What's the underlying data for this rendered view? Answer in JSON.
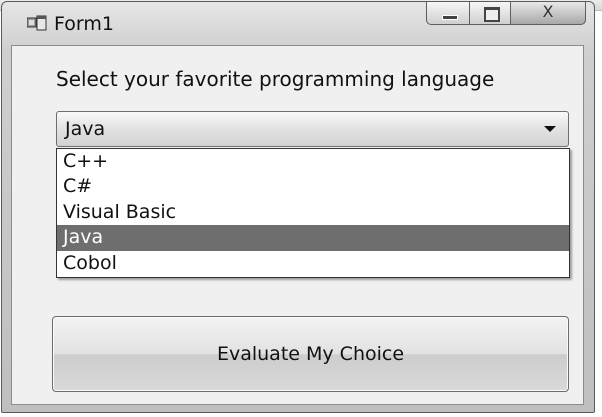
{
  "window": {
    "title": "Form1",
    "controls": {
      "minimize": "minimize",
      "maximize": "maximize",
      "close": "X"
    }
  },
  "form": {
    "prompt": "Select your favorite programming language",
    "combo": {
      "selected": "Java",
      "options": [
        "C++",
        "C#",
        "Visual Basic",
        "Java",
        "Cobol"
      ],
      "highlighted_index": 3
    },
    "button_label": "Evaluate My Choice"
  }
}
